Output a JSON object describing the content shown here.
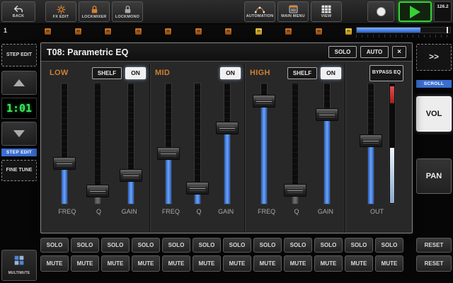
{
  "topbar": {
    "back": {
      "label": "BACK"
    },
    "fx_edit": {
      "label": "FX EDIT"
    },
    "lock_mixer": {
      "label": "LOCKMIXER"
    },
    "lock_mono": {
      "label": "LOCKMONO"
    },
    "automation": {
      "label": "AUTOMATION"
    },
    "main_menu": {
      "label": "MAIN MENU"
    },
    "view": {
      "label": "VIEW"
    },
    "tempo": "126.2"
  },
  "position_row": {
    "bar_number": "1",
    "indicators": [
      "orange",
      "orange",
      "orange",
      "orange",
      "orange",
      "orange",
      "orange",
      "yellow",
      "orange",
      "orange",
      "yellow"
    ],
    "progress": 0.68
  },
  "left_panel": {
    "step_edit_button": "STEP EDIT",
    "position_display": "1:01",
    "mode_label": "STEP EDIT",
    "fine_tune_button": "FINE TUNE"
  },
  "right_panel": {
    "scroll_button": ">>",
    "scroll_label": "SCROLL",
    "vol_button": "VOL",
    "pan_button": "PAN"
  },
  "dialog": {
    "title": "T08: Parametric EQ",
    "solo_button": "SOLO",
    "auto_button": "AUTO",
    "close_button": "×",
    "bands": [
      {
        "name": "LOW",
        "shelf_label": "SHELF",
        "on_label": "ON",
        "sliders": [
          {
            "label": "FREQ",
            "value": 0.31
          },
          {
            "label": "Q",
            "value": 0.05,
            "disabled": true
          },
          {
            "label": "GAIN",
            "value": 0.2
          }
        ]
      },
      {
        "name": "MID",
        "on_label": "ON",
        "sliders": [
          {
            "label": "FREQ",
            "value": 0.4
          },
          {
            "label": "Q",
            "value": 0.08
          },
          {
            "label": "GAIN",
            "value": 0.64
          }
        ]
      },
      {
        "name": "HIGH",
        "shelf_label": "SHELF",
        "on_label": "ON",
        "sliders": [
          {
            "label": "FREQ",
            "value": 0.89
          },
          {
            "label": "Q",
            "value": 0.06,
            "disabled": true
          },
          {
            "label": "GAIN",
            "value": 0.76
          }
        ]
      }
    ],
    "out": {
      "bypass_label": "BYPASS EQ",
      "slider": {
        "label": "OUT",
        "value": 0.52
      },
      "meter": {
        "clip": true,
        "level": 0.46
      }
    }
  },
  "mixer": {
    "track_count": 12,
    "solo_label": "SOLO",
    "mute_label": "MUTE",
    "reset_label": "RESET",
    "multimute_label": "MULTIMUTE"
  },
  "colors": {
    "accent_blue": "#4a86d8",
    "accent_orange": "#c8772e",
    "play_green": "#35d035",
    "lcd_green": "#3ae85a",
    "indicator_orange": "#c87028",
    "indicator_yellow": "#e8c840",
    "on_button_bg": "#f0f0f0",
    "meter_clip_red": "#c23030"
  }
}
